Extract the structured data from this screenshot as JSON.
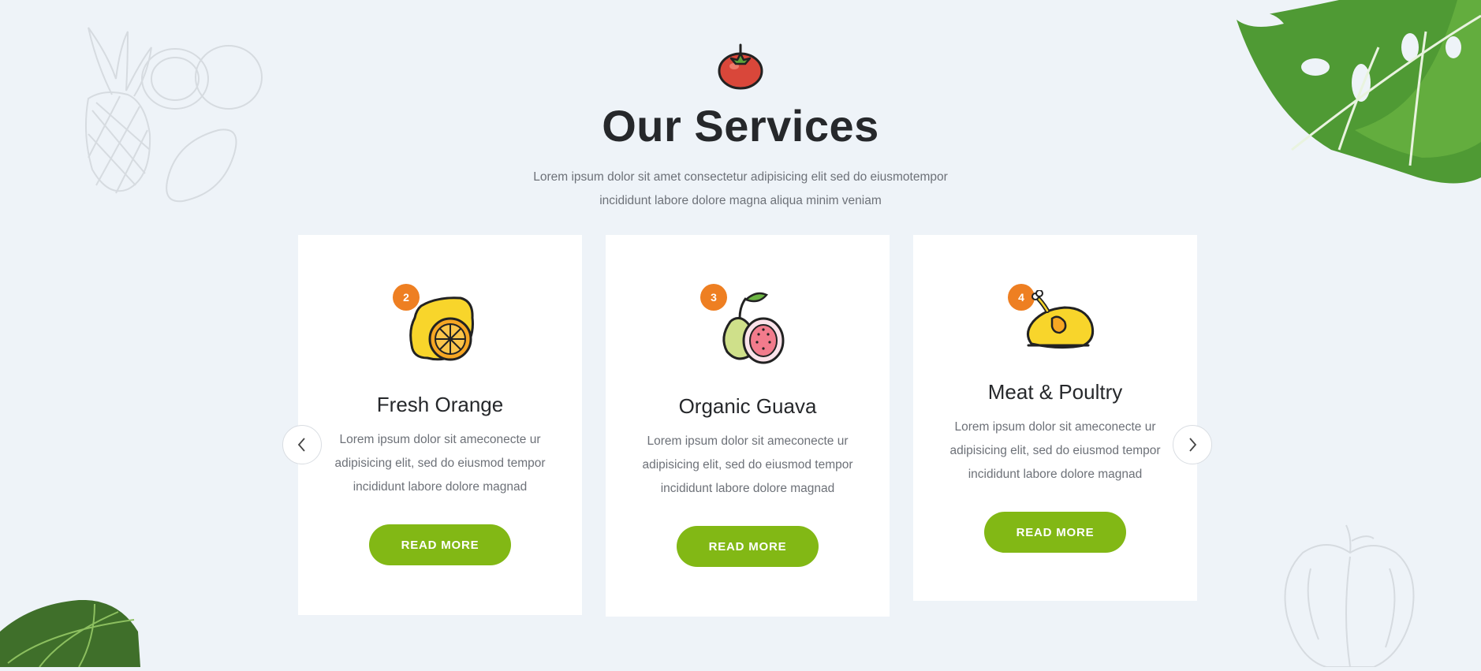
{
  "section": {
    "icon": "tomato-icon",
    "title": "Our Services",
    "subtitle_line1": "Lorem ipsum dolor sit amet consectetur adipisicing elit sed do eiusmotempor",
    "subtitle_line2": "incididunt labore dolore magna aliqua minim veniam"
  },
  "cards": [
    {
      "number": "2",
      "icon": "lemon-icon",
      "title": "Fresh Orange",
      "text": "Lorem ipsum dolor sit ameconecte ur adipisicing elit, sed do eiusmod tempor incididunt labore dolore magnad",
      "button": "READ MORE"
    },
    {
      "number": "3",
      "icon": "guava-icon",
      "title": "Organic Guava",
      "text": "Lorem ipsum dolor sit ameconecte ur adipisicing elit, sed do eiusmod tempor incididunt labore dolore magnad",
      "button": "READ MORE"
    },
    {
      "number": "4",
      "icon": "roast-chicken-icon",
      "title": "Meat & Poultry",
      "text": "Lorem ipsum dolor sit ameconecte ur adipisicing elit, sed do eiusmod tempor incididunt labore dolore magnad",
      "button": "READ MORE"
    }
  ],
  "nav": {
    "prev_icon": "chevron-left-icon",
    "next_icon": "chevron-right-icon"
  },
  "colors": {
    "background": "#eef3f8",
    "accent_green": "#82b815",
    "badge_orange": "#ee7f22",
    "title_dark": "#26282b",
    "text_gray": "#6d7178"
  },
  "decorations": [
    "fruit-sketch-icon",
    "monstera-leaf-icon",
    "apple-sketch-icon"
  ]
}
